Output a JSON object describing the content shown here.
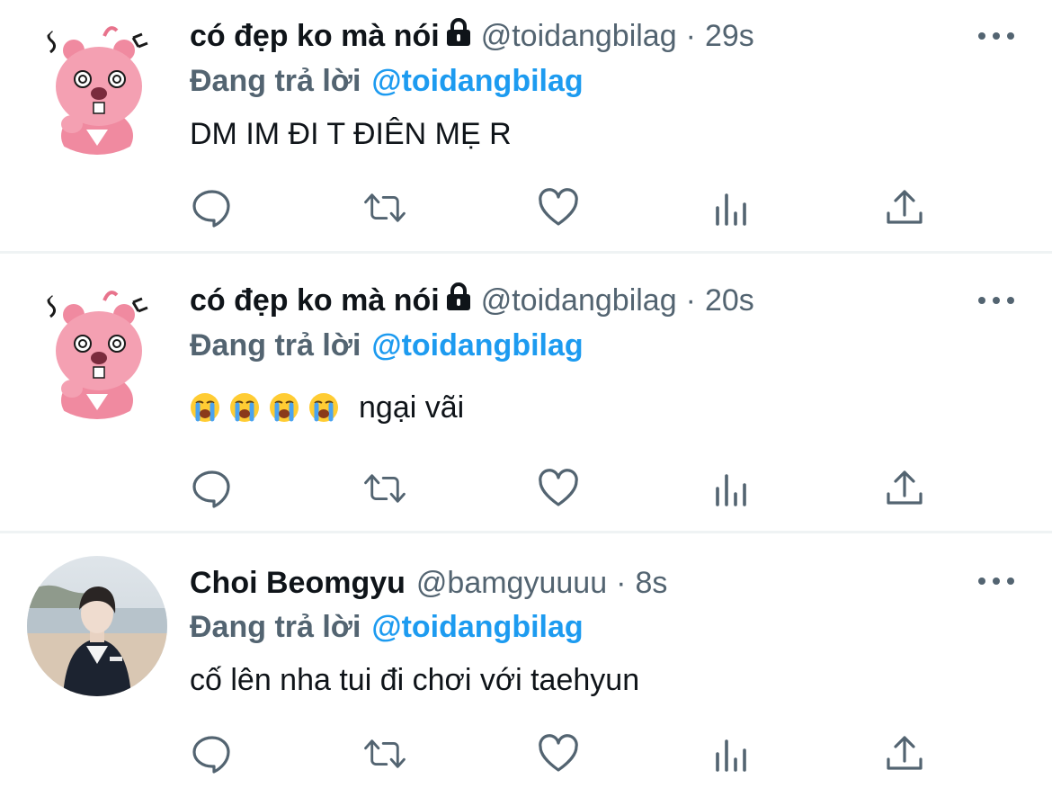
{
  "tweets": [
    {
      "display_name": "có đẹp ko mà nói",
      "protected": true,
      "handle": "@toidangbilag",
      "separator": "·",
      "time": "29s",
      "reply_prefix": "Đang trả lời",
      "reply_to": "@toidangbilag",
      "text": "DM IM ĐI T ĐIÊN MẸ R",
      "avatar": "pink-beaver-cartoon",
      "emojis": []
    },
    {
      "display_name": "có đẹp ko mà nói",
      "protected": true,
      "handle": "@toidangbilag",
      "separator": "·",
      "time": "20s",
      "reply_prefix": "Đang trả lời",
      "reply_to": "@toidangbilag",
      "text": "ngại vãi",
      "avatar": "pink-beaver-cartoon",
      "emojis": [
        "loudly-crying-face",
        "loudly-crying-face",
        "loudly-crying-face",
        "loudly-crying-face"
      ]
    },
    {
      "display_name": "Choi Beomgyu",
      "protected": false,
      "handle": "@bamgyuuuu",
      "separator": "·",
      "time": "8s",
      "reply_prefix": "Đang trả lời",
      "reply_to": "@toidangbilag",
      "text": "cố lên nha tui đi chơi với taehyun",
      "avatar": "person-photo-beach",
      "emojis": []
    }
  ],
  "actions": [
    "reply-icon",
    "retweet-icon",
    "like-icon",
    "analytics-icon",
    "share-icon"
  ],
  "colors": {
    "text": "#0f1419",
    "secondary": "#536471",
    "accent": "#1d9bf0",
    "divider": "#eff3f4"
  }
}
